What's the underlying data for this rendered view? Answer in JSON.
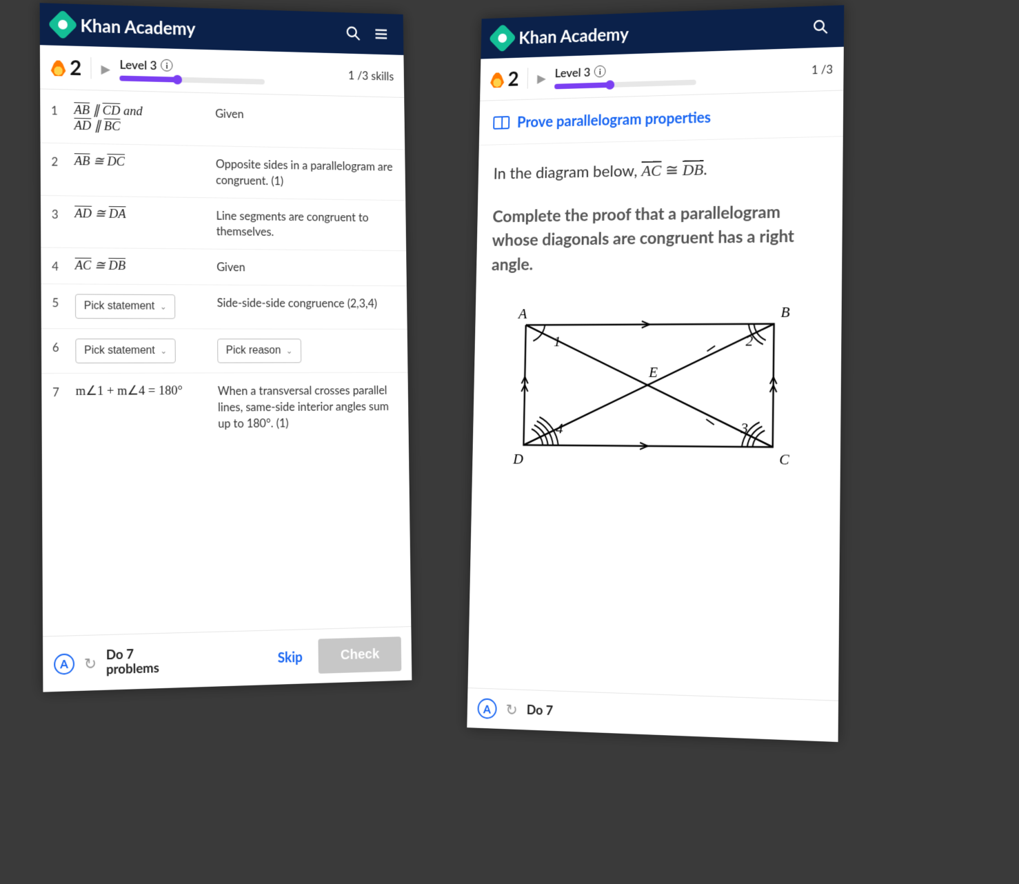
{
  "brand": "Khan Academy",
  "left": {
    "streak": "2",
    "level_label": "Level 3",
    "skills_text": "1 /3 skills",
    "rows": [
      {
        "num": "1",
        "stmt_html": "<span class='ov'>AB</span> ∥ <span class='ov'>CD</span> and<br><span class='ov'>AD</span> ∥ <span class='ov'>BC</span>",
        "reason": "Given"
      },
      {
        "num": "2",
        "stmt_html": "<span class='ov'>AB</span> ≅ <span class='ov'>DC</span>",
        "reason": "Opposite sides in a parallelogram are congruent. (1)"
      },
      {
        "num": "3",
        "stmt_html": "<span class='ov'>AD</span> ≅ <span class='ov'>DA</span>",
        "reason": "Line segments are congruent to themselves."
      },
      {
        "num": "4",
        "stmt_html": "<span class='ov'>AC</span> ≅ <span class='ov'>DB</span>",
        "reason": "Given"
      },
      {
        "num": "5",
        "stmt_drop": "Pick statement",
        "reason": "Side-side-side congruence (2,3,4)"
      },
      {
        "num": "6",
        "stmt_drop": "Pick statement",
        "reason_drop": "Pick reason"
      },
      {
        "num": "7",
        "stmt_html": "m∠1 + m∠4 = 180°",
        "reason": "When a transversal crosses parallel lines, same-side interior angles sum up to 180°. (1)"
      }
    ],
    "do_label": "Do 7\nproblems",
    "skip_label": "Skip",
    "check_label": "Check"
  },
  "right": {
    "streak": "2",
    "level_label": "Level 3",
    "skills_text": "1 /3",
    "lesson_title": "Prove parallelogram properties",
    "q_intro": "In the diagram below,",
    "q_congr_left": "AC",
    "q_congr_right": "DB",
    "q_prompt": "Complete the proof that a parallelogram whose diagonals are congruent has a right angle.",
    "labels": {
      "A": "A",
      "B": "B",
      "C": "C",
      "D": "D",
      "E": "E",
      "a1": "1",
      "a2": "2",
      "a3": "3",
      "a4": "4"
    },
    "do_label": "Do 7"
  }
}
